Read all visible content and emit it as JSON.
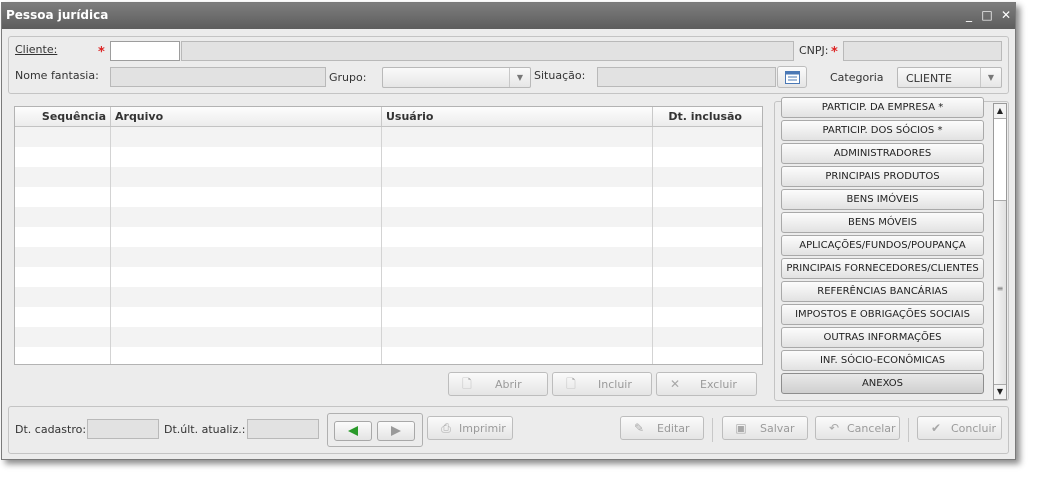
{
  "window": {
    "title": "Pessoa jurídica"
  },
  "titlebar": {
    "minimize": "_",
    "maximize": "□",
    "close": "✕"
  },
  "form": {
    "cliente_label": "Cliente:",
    "required_mark": "*",
    "cnpj_label": "CNPJ:",
    "nome_fantasia_label": "Nome fantasia:",
    "grupo_label": "Grupo:",
    "situacao_label": "Situação:",
    "categoria_label": "Categoria",
    "categoria_value": "CLIENTE"
  },
  "table": {
    "columns": [
      "Sequência",
      "Arquivo",
      "Usuário",
      "Dt. inclusão"
    ]
  },
  "table_actions": {
    "abrir": "Abrir",
    "incluir": "Incluir",
    "excluir": "Excluir"
  },
  "sidebar": {
    "items": [
      "PARTICIP. DA EMPRESA *",
      "PARTICIP. DOS SÓCIOS *",
      "ADMINISTRADORES",
      "PRINCIPAIS PRODUTOS",
      "BENS IMÓVEIS",
      "BENS MÓVEIS",
      "APLICAÇÕES/FUNDOS/POUPANÇA",
      "PRINCIPAIS FORNECEDORES/CLIENTES",
      "REFERÊNCIAS BANCÁRIAS",
      "IMPOSTOS E OBRIGAÇÕES SOCIAIS",
      "OUTRAS INFORMAÇÕES",
      "INF. SÓCIO-ECONÔMICAS",
      "ANEXOS"
    ],
    "active": "ANEXOS"
  },
  "footer": {
    "dt_cadastro_label": "Dt. cadastro:",
    "dt_ult_atualiz_label": "Dt.últ. atualiz.:",
    "imprimir": "Imprimir",
    "editar": "Editar",
    "salvar": "Salvar",
    "cancelar": "Cancelar",
    "concluir": "Concluir"
  },
  "colors": {
    "titlebar": "#6c6c6c",
    "required": "#dd2222",
    "nav_arrow": "#2a9a2a"
  }
}
